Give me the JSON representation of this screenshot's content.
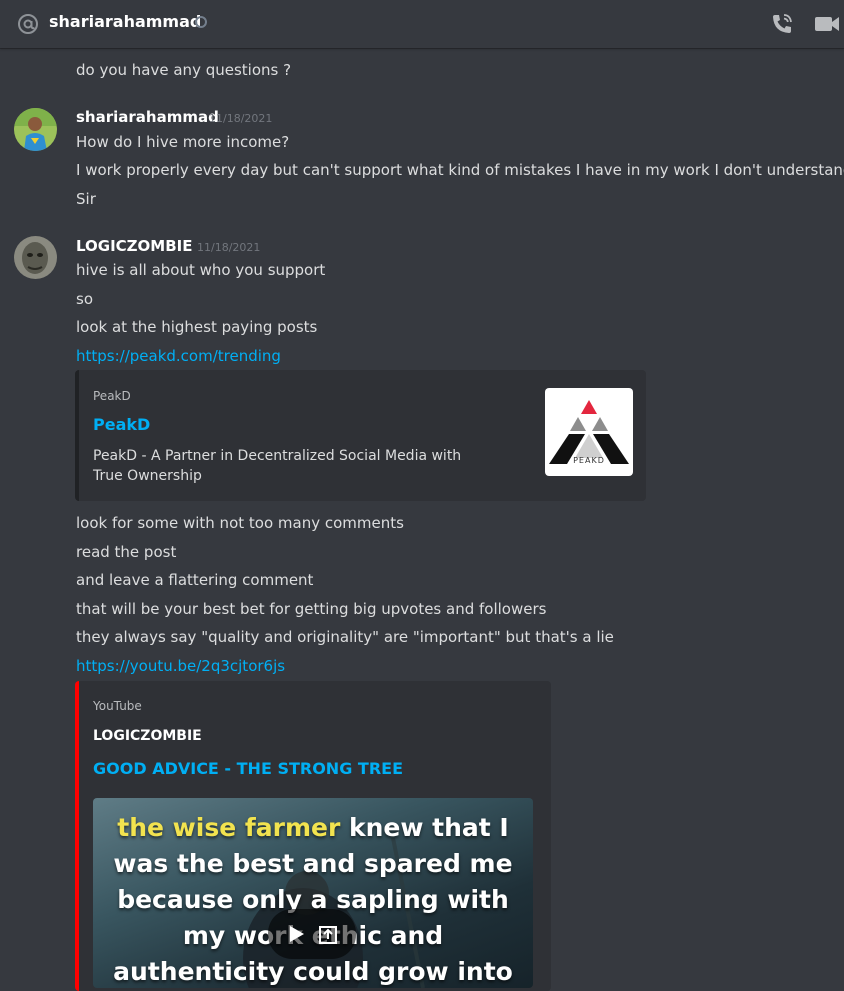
{
  "header": {
    "channel_name": "shariarahammad",
    "icons": [
      "at-icon",
      "status-offline-icon",
      "voice-call-icon",
      "video-call-icon"
    ]
  },
  "messages": {
    "prev_tail": "do you have any questions ?",
    "msg1": {
      "author": "shariarahammad",
      "timestamp": "11/18/2021",
      "lines": [
        "How do I hive more income?",
        "I work properly every day but can't support what kind of mistakes I have in my work I don't understand",
        "Sir"
      ]
    },
    "msg2": {
      "author": "LOGICZOMBIE",
      "timestamp": "11/18/2021",
      "lines": [
        "hive is all about who you support",
        "so",
        "look at the highest paying posts"
      ],
      "link1": "https://peakd.com/trending",
      "embed1": {
        "provider": "PeakD",
        "title": "PeakD",
        "description": "PeakD - A Partner in Decentralized Social Media with True Ownership",
        "thumb_label": "PEAKD"
      },
      "lines2": [
        "look for some with not too many comments",
        "read the post",
        "and leave a flattering comment",
        "that will be your best bet for getting big upvotes and followers",
        "they always say \"quality and originality\" are \"important\" but that's a lie"
      ],
      "link2": "https://youtu.be/2q3cjtor6js",
      "embed2": {
        "provider": "YouTube",
        "author": "LOGICZOMBIE",
        "title": "GOOD ADVICE - THE STRONG TREE",
        "caption_highlight": "the wise farmer",
        "caption_lines": [
          " knew that I",
          "was the best and spared me",
          "because only a sapling with",
          "my work ethic and",
          "authenticity could grow into"
        ]
      }
    }
  },
  "colors": {
    "background": "#36393f",
    "link": "#00aff4",
    "embed_bg": "#2f3136",
    "youtube_accent": "#ff0000",
    "timestamp": "#72767d"
  }
}
